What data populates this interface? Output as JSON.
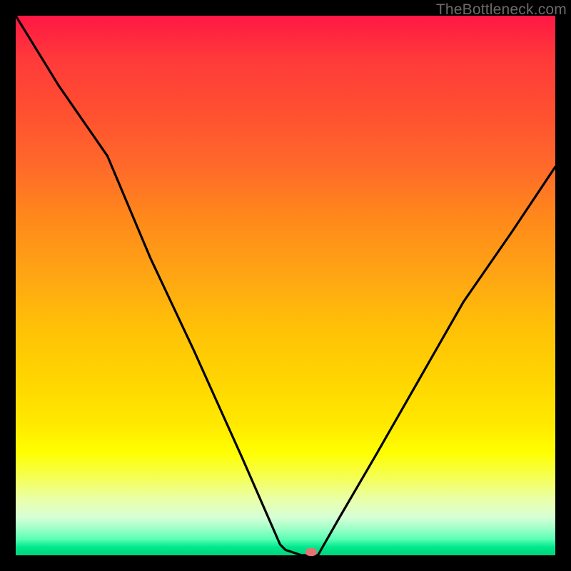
{
  "credit": "TheBottleneck.com",
  "chart_data": {
    "type": "line",
    "title": "",
    "xlabel": "",
    "ylabel": "",
    "xlim": [
      0,
      100
    ],
    "ylim": [
      0,
      100
    ],
    "grid": false,
    "legend": false,
    "series": [
      {
        "name": "bottleneck-curve",
        "x": [
          0,
          8,
          17,
          25,
          33,
          42,
          49,
          50,
          53,
          56,
          60,
          67,
          75,
          83,
          92,
          100
        ],
        "values": [
          100,
          87,
          74,
          55,
          38,
          18,
          2,
          1,
          0,
          0,
          7,
          19,
          33,
          47,
          60,
          72
        ]
      }
    ],
    "marker": {
      "x": 54.8,
      "y": 0.6
    },
    "background_gradient": [
      {
        "pos": 0.0,
        "color": "#ff1744"
      },
      {
        "pos": 0.2,
        "color": "#ff5030"
      },
      {
        "pos": 0.4,
        "color": "#ff8a1a"
      },
      {
        "pos": 0.6,
        "color": "#ffc107"
      },
      {
        "pos": 0.8,
        "color": "#ffff00"
      },
      {
        "pos": 0.95,
        "color": "#a0ffc8"
      },
      {
        "pos": 1.0,
        "color": "#00d47a"
      }
    ]
  },
  "layout": {
    "inner_left": 22,
    "inner_top": 22,
    "inner_width": 756,
    "inner_height": 756
  }
}
